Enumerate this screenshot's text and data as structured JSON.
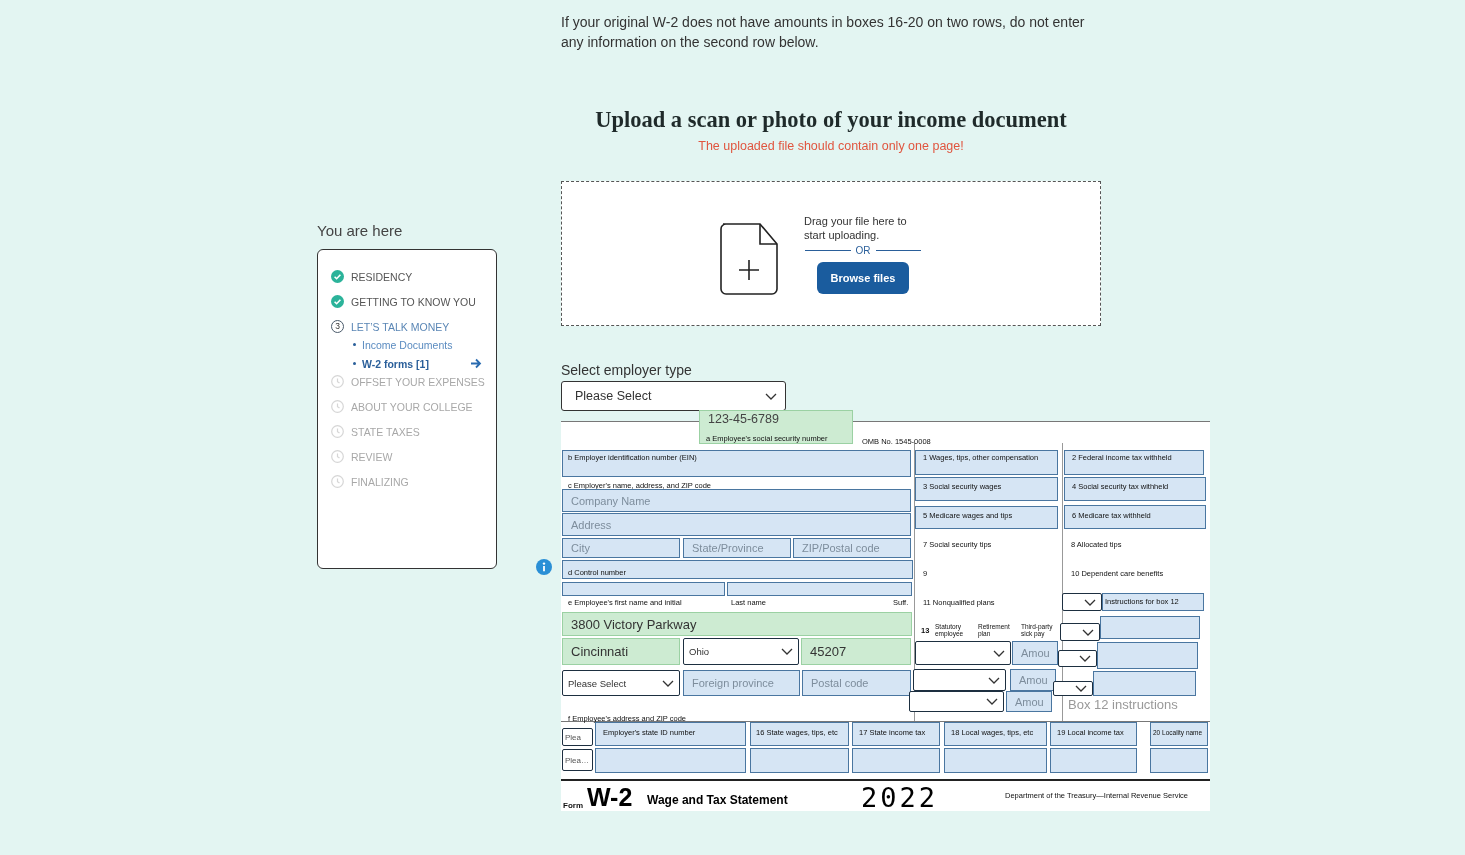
{
  "intro": "If your original W-2 does not have amounts in boxes 16-20 on two rows, do not enter any information on the second row below.",
  "upload": {
    "title": "Upload a scan or photo of your income document",
    "warning": "The uploaded file should contain only one page!",
    "drop_text": "Drag your file here to start uploading.",
    "or": "OR",
    "button": "Browse files"
  },
  "progress": {
    "heading": "You are here",
    "steps": [
      {
        "label": "RESIDENCY",
        "done": true,
        "current": false
      },
      {
        "label": "GETTING TO KNOW YOU",
        "done": true,
        "current": false
      },
      {
        "label": "LET’S TALK MONEY",
        "done": false,
        "current": true,
        "number": "3",
        "children": [
          {
            "label": "Income Documents",
            "selected": false
          },
          {
            "label": "W-2 forms [1]",
            "selected": true
          }
        ]
      },
      {
        "label": "OFFSET YOUR EXPENSES",
        "done": false,
        "current": false
      },
      {
        "label": "ABOUT YOUR COLLEGE",
        "done": false,
        "current": false
      },
      {
        "label": "STATE TAXES",
        "done": false,
        "current": false
      },
      {
        "label": "REVIEW",
        "done": false,
        "current": false
      },
      {
        "label": "FINALIZING",
        "done": false,
        "current": false
      }
    ]
  },
  "employer_type": {
    "label": "Select employer type",
    "value": "Please Select"
  },
  "w2": {
    "items": [
      {
        "kind": "field",
        "value": "123-45-6789",
        "autofilled": true
      },
      {
        "kind": "label",
        "text": "a Employee's social security number"
      },
      {
        "kind": "label",
        "text": "OMB No. 1545-0008"
      },
      {
        "kind": "field",
        "autofilled": false
      },
      {
        "kind": "label",
        "text": "b Employer identification number (EIN)"
      },
      {
        "kind": "label",
        "text": "c Employer's name, address, and ZIP code"
      },
      {
        "kind": "field",
        "placeholder": "Company Name",
        "autofilled": false
      },
      {
        "kind": "field",
        "placeholder": "Address",
        "autofilled": false
      },
      {
        "kind": "field",
        "placeholder": "City",
        "autofilled": false
      },
      {
        "kind": "field",
        "placeholder": "State/Province",
        "autofilled": false
      },
      {
        "kind": "field",
        "placeholder": "ZIP/Postal code",
        "autofilled": false
      },
      {
        "kind": "field",
        "autofilled": false
      },
      {
        "kind": "label",
        "text": "d Control number"
      },
      {
        "kind": "field",
        "autofilled": false
      },
      {
        "kind": "field",
        "autofilled": false
      },
      {
        "kind": "label",
        "text": "e Employee's first name and initial"
      },
      {
        "kind": "label",
        "text": "Last name"
      },
      {
        "kind": "label",
        "text": "Suff."
      },
      {
        "kind": "field",
        "value": "3800 Victory Parkway",
        "autofilled": true
      },
      {
        "kind": "field",
        "value": "Cincinnati",
        "autofilled": true
      },
      {
        "kind": "select",
        "value": "Ohio"
      },
      {
        "kind": "field",
        "value": "45207",
        "autofilled": true
      },
      {
        "kind": "select",
        "value": "Please Select"
      },
      {
        "kind": "field",
        "placeholder": "Foreign province",
        "autofilled": false
      },
      {
        "kind": "field",
        "placeholder": "Postal code",
        "autofilled": false
      },
      {
        "kind": "label",
        "text": "f Employee's address and ZIP code"
      },
      {
        "kind": "field",
        "autofilled": false
      },
      {
        "kind": "label",
        "text": "1 Wages, tips, other compensation"
      },
      {
        "kind": "field",
        "autofilled": false
      },
      {
        "kind": "label",
        "text": "2 Federal income tax withheld"
      },
      {
        "kind": "field",
        "autofilled": false
      },
      {
        "kind": "label",
        "text": "3 Social security wages"
      },
      {
        "kind": "field",
        "autofilled": false
      },
      {
        "kind": "label",
        "text": "4 Social security tax withheld"
      },
      {
        "kind": "field",
        "autofilled": false
      },
      {
        "kind": "label",
        "text": "5 Medicare wages and tips"
      },
      {
        "kind": "field",
        "autofilled": false
      },
      {
        "kind": "label",
        "text": "6 Medicare tax withheld"
      },
      {
        "kind": "label",
        "text": "7 Social security tips"
      },
      {
        "kind": "label",
        "text": "8 Allocated tips"
      },
      {
        "kind": "label",
        "text": "9"
      },
      {
        "kind": "label",
        "text": "10 Dependent care benefits"
      },
      {
        "kind": "label",
        "text": "11 Nonqualified plans"
      },
      {
        "kind": "select"
      },
      {
        "kind": "field",
        "autofilled": false
      },
      {
        "kind": "label",
        "text": "Instructions for box 12"
      },
      {
        "kind": "label",
        "text": "13"
      },
      {
        "kind": "label",
        "text": "Statutory employee"
      },
      {
        "kind": "label",
        "text": "Retirement plan"
      },
      {
        "kind": "label",
        "text": "Third-party sick pay"
      },
      {
        "kind": "select"
      },
      {
        "kind": "field",
        "autofilled": false
      },
      {
        "kind": "select"
      },
      {
        "kind": "field",
        "placeholder": "Amou",
        "autofilled": false
      },
      {
        "kind": "select"
      },
      {
        "kind": "field",
        "autofilled": false
      },
      {
        "kind": "select"
      },
      {
        "kind": "field",
        "placeholder": "Amou",
        "autofilled": false
      },
      {
        "kind": "select"
      },
      {
        "kind": "field",
        "autofilled": false
      },
      {
        "kind": "select"
      },
      {
        "kind": "field",
        "placeholder": "Amou",
        "autofilled": false
      },
      {
        "kind": "hint",
        "text": "Box 12 instructions"
      },
      {
        "kind": "select",
        "value": "Plea"
      },
      {
        "kind": "select",
        "value": "Plea…"
      },
      {
        "kind": "field",
        "autofilled": false
      },
      {
        "kind": "label",
        "text": "Employer's state ID number"
      },
      {
        "kind": "field",
        "autofilled": false
      },
      {
        "kind": "label",
        "text": "16 State wages, tips, etc"
      },
      {
        "kind": "field",
        "autofilled": false
      },
      {
        "kind": "label",
        "text": "17 State income tax"
      },
      {
        "kind": "field",
        "autofilled": false
      },
      {
        "kind": "label",
        "text": "18 Local wages, tips, etc"
      },
      {
        "kind": "field",
        "autofilled": false
      },
      {
        "kind": "label",
        "text": "19 Local income tax"
      },
      {
        "kind": "field",
        "autofilled": false
      },
      {
        "kind": "label",
        "text": "20 Locality name"
      },
      {
        "kind": "field",
        "autofilled": false
      },
      {
        "kind": "field",
        "autofilled": false
      },
      {
        "kind": "field",
        "autofilled": false
      },
      {
        "kind": "field",
        "autofilled": false
      },
      {
        "kind": "field",
        "autofilled": false
      },
      {
        "kind": "field",
        "autofilled": false
      },
      {
        "kind": "label",
        "text": "Form"
      },
      {
        "kind": "label",
        "text": "W-2"
      },
      {
        "kind": "label",
        "text": "Wage and Tax Statement"
      },
      {
        "kind": "label",
        "text": "2022"
      },
      {
        "kind": "label",
        "text": "Department of the Treasury—Internal Revenue Service"
      }
    ]
  }
}
